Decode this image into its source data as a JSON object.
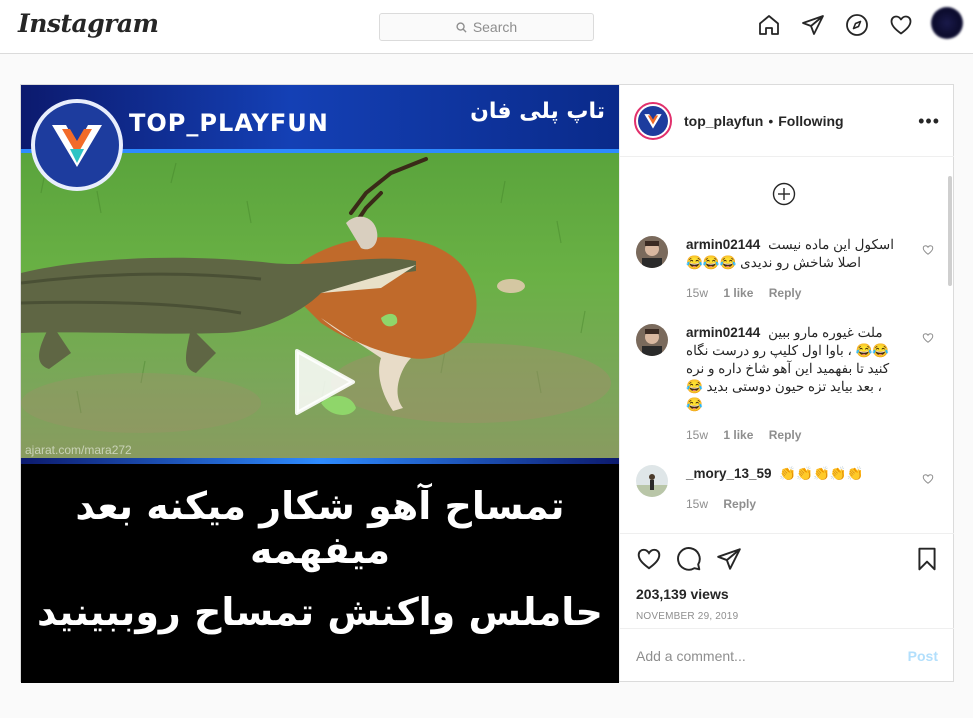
{
  "topbar": {
    "logo": "Instagram",
    "search_placeholder": "Search",
    "icons": [
      "home-icon",
      "direct-icon",
      "explore-icon",
      "activity-heart-icon",
      "profile-avatar"
    ]
  },
  "post": {
    "media": {
      "brand_name": "TOP_PLAYFUN",
      "brand_name_fa": "تاپ پلی فان",
      "watermark": "ajarat.com/mara272",
      "caption_line_1": "تمساح آهو شکار میکنه بعد میفهمه",
      "caption_line_2": "حاملس واکنش تمساح روببینید"
    },
    "header": {
      "username": "top_playfun",
      "separator": "•",
      "follow_status": "Following",
      "more": "•••"
    },
    "comments": [
      {
        "username": "armin02144",
        "text": "اسکول این ماده نیست اصلا شاخش رو ندیدی 😂😂😂",
        "time": "15w",
        "likes": "1 like",
        "reply": "Reply"
      },
      {
        "username": "armin02144",
        "text": "ملت غیوره مارو ببین 😂😂 ، باوا اول کلیپ رو درست نگاه کنید تا بفهمید این آهو شاخ داره و نره ، بعد بیاید تزه حیون دوستی بدید 😂😂",
        "time": "15w",
        "likes": "1 like",
        "reply": "Reply"
      },
      {
        "username": "_mory_13_59",
        "text": "👏👏👏👏👏",
        "time": "15w",
        "likes": "",
        "reply": "Reply"
      }
    ],
    "views": "203,139 views",
    "date": "NOVEMBER 29, 2019",
    "add_comment_placeholder": "Add a comment...",
    "post_button": "Post"
  },
  "colors": {
    "border": "#dbdbdb",
    "muted": "#8e8e8e",
    "post_button": "#b2dffc",
    "brand_blue": "#1d3c9e"
  }
}
